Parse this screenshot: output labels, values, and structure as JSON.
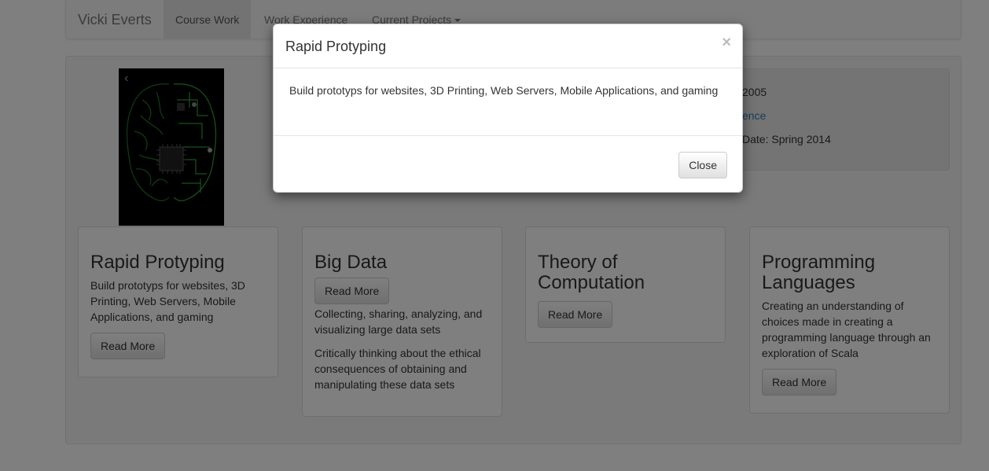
{
  "navbar": {
    "brand": "Vicki Everts",
    "items": [
      {
        "label": "Course Work"
      },
      {
        "label": "Work Experience"
      },
      {
        "label": "Current Projects"
      }
    ]
  },
  "carousel": {
    "prev": "‹",
    "next": "›"
  },
  "info": {
    "line1": "2005",
    "line2_link": "ence",
    "line3": "Date: Spring 2014"
  },
  "cards": [
    {
      "title": "Rapid Protyping",
      "paragraphs": [
        "Build prototyps for websites, 3D Printing, Web Servers, Mobile Applications, and gaming"
      ],
      "button": "Read More"
    },
    {
      "title": "Big Data",
      "paragraphs": [
        "Collecting, sharing, analyzing, and visualizing large data sets",
        "Critically thinking about the ethical consequences of obtaining and manipulating these data sets"
      ],
      "button": "Read More"
    },
    {
      "title": "Theory of Computation",
      "paragraphs": [],
      "button": "Read More"
    },
    {
      "title": "Programming Languages",
      "paragraphs": [
        "Creating an understanding of choices made in creating a programming language through an exploration of Scala"
      ],
      "button": "Read More"
    }
  ],
  "modal": {
    "title": "Rapid Protyping",
    "close_symbol": "×",
    "body": "Build prototyps for websites, 3D Printing, Web Servers, Mobile Applications, and gaming",
    "close_button": "Close"
  }
}
